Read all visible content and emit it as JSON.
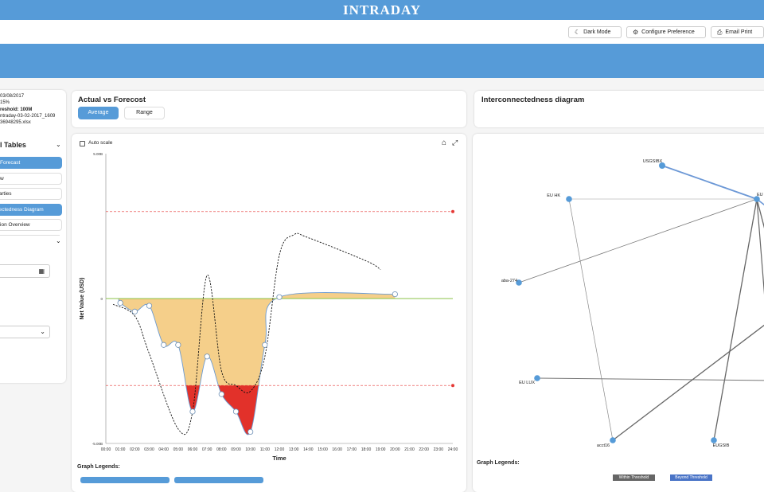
{
  "app": {
    "title": "INTRADAY"
  },
  "toolbar": {
    "dark_mode": "Dark Mode",
    "configure": "Configure Preference",
    "email_print": "Email Print"
  },
  "left_panel": {
    "info": [
      "03/08/2017",
      "15%",
      "reshold: 100M",
      "ntraday-03-02-2017_1609",
      "36948295.xlsx"
    ],
    "section_title": "l Tables",
    "nav_items": [
      {
        "label": "s Forecast",
        "active": true
      },
      {
        "label": "iew",
        "active": false
      },
      {
        "label": "parties",
        "active": false
      },
      {
        "label": "nectedness Diagram",
        "active": true
      },
      {
        "label": "ction Overview",
        "active": false
      }
    ]
  },
  "actual_vs_forecast": {
    "title": "Actual vs Forecost",
    "tabs": [
      "Average",
      "Range"
    ],
    "selected_tab": "Average"
  },
  "interconnectedness": {
    "title": "Interconnectedness diagram"
  },
  "chart_panel": {
    "auto_scale_label": "Auto scale",
    "auto_scale_checked": false,
    "legend_title": "Graph Legends:"
  },
  "network_panel": {
    "legend_title": "Graph Legends:",
    "legend_items": [
      "Within Threshold",
      "Beyond Threshold"
    ]
  },
  "colors": {
    "header_blue": "#569bd8",
    "area_fill": "#f5cf8a",
    "beyond_fill": "#e2312a",
    "zero_line": "#8bc34a",
    "threshold": "#e53935"
  },
  "chart_data": {
    "type": "area",
    "title": "",
    "xlabel": "Time",
    "ylabel": "Net Value (USD)",
    "x_ticks": [
      "00:00",
      "01:00",
      "02:00",
      "03:00",
      "04:00",
      "05:00",
      "06:00",
      "07:00",
      "08:00",
      "09:00",
      "10:00",
      "11:00",
      "12:00",
      "13:00",
      "14:00",
      "15:00",
      "16:00",
      "17:00",
      "18:00",
      "19:00",
      "20:00",
      "21:00",
      "22:00",
      "23:00",
      "24:00"
    ],
    "y_ticks": [
      "5.00B",
      "0",
      "-5.00B"
    ],
    "ylim": [
      -5.0,
      5.0
    ],
    "thresholds": [
      3.0,
      -3.0
    ],
    "series": [
      {
        "style": "area",
        "points": [
          [
            0.9,
            0
          ],
          [
            1.0,
            -0.15
          ],
          [
            2.0,
            -0.45
          ],
          [
            3.0,
            -0.25
          ],
          [
            4.0,
            -1.6
          ],
          [
            5.0,
            -1.6
          ],
          [
            6.0,
            -3.9
          ],
          [
            7.0,
            -2.0
          ],
          [
            8.0,
            -3.3
          ],
          [
            9.0,
            -3.9
          ],
          [
            10.0,
            -4.6
          ],
          [
            11.0,
            -1.6
          ],
          [
            12.0,
            0.05
          ],
          [
            20.0,
            0.15
          ]
        ]
      },
      {
        "style": "dashed",
        "points": [
          [
            0.5,
            -0.2
          ],
          [
            2.0,
            -0.6
          ],
          [
            3.0,
            -1.9
          ],
          [
            5.0,
            -4.5
          ],
          [
            6.0,
            -3.9
          ],
          [
            7.0,
            0.8
          ],
          [
            8.0,
            -2.5
          ],
          [
            9.0,
            -3.0
          ],
          [
            10.0,
            -3.2
          ],
          [
            11.0,
            -2.0
          ],
          [
            12.0,
            1.5
          ],
          [
            13.0,
            2.2
          ],
          [
            14.0,
            2.1
          ],
          [
            18.0,
            1.3
          ],
          [
            19.0,
            1.0
          ]
        ]
      }
    ]
  },
  "network": {
    "nodes": [
      "USGSIBX",
      "EU HK",
      "aba-274",
      "EU LUX",
      "acct16",
      "EUGSIB",
      "EU"
    ]
  }
}
